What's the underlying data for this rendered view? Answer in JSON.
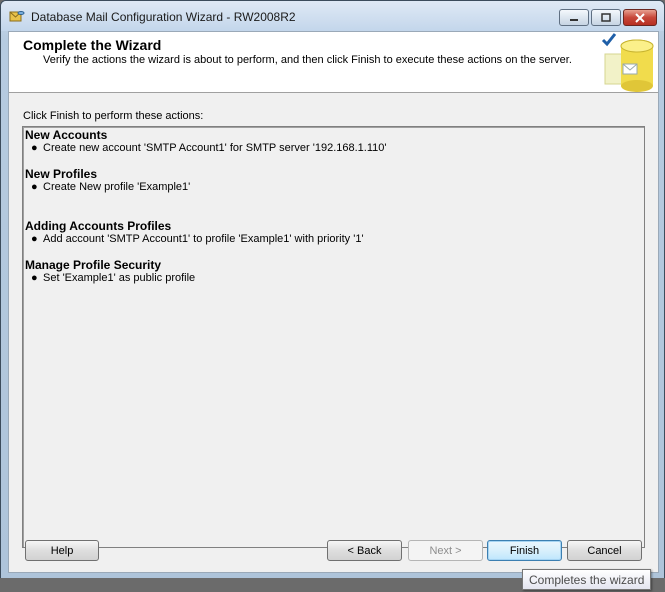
{
  "window": {
    "title": "Database Mail Configuration Wizard - RW2008R2"
  },
  "header": {
    "title": "Complete the Wizard",
    "subtitle": "Verify the actions the wizard is about to perform, and then click Finish to execute these actions on the server."
  },
  "body": {
    "instruction": "Click Finish to perform these actions:",
    "groups": [
      {
        "title": "New Accounts",
        "items": [
          "Create new account 'SMTP Account1' for SMTP server '192.168.1.110'"
        ]
      },
      {
        "title": "New Profiles",
        "items": [
          "Create New profile 'Example1'"
        ]
      },
      {
        "title": "Adding Accounts Profiles",
        "items": [
          "Add account 'SMTP Account1' to profile 'Example1' with priority '1'"
        ]
      },
      {
        "title": "Manage Profile Security",
        "items": [
          "Set 'Example1' as public profile"
        ]
      }
    ]
  },
  "buttons": {
    "help": "Help",
    "back": "< Back",
    "next": "Next >",
    "finish": "Finish",
    "cancel": "Cancel"
  },
  "tooltip": "Completes the wizard",
  "colors": {
    "close_button": "#c7473a",
    "header_bg": "#ffffff",
    "dialog_bg": "#f0f0f0"
  }
}
